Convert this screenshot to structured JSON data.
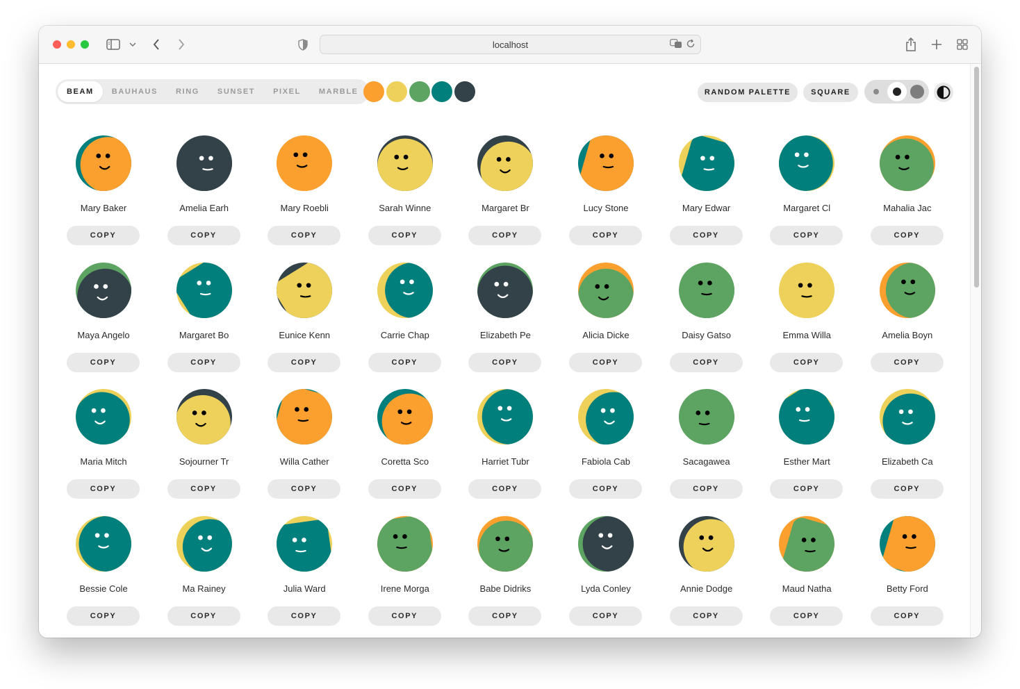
{
  "browser": {
    "url": "localhost",
    "traffic_lights": [
      "#ff5f57",
      "#febc2e",
      "#28c840"
    ]
  },
  "variants": {
    "tabs": [
      "BEAM",
      "BAUHAUS",
      "RING",
      "SUNSET",
      "PIXEL",
      "MARBLE"
    ],
    "active": "BEAM"
  },
  "palette": [
    "#fba02e",
    "#edd15b",
    "#5da361",
    "#007f7d",
    "#334149"
  ],
  "actions": {
    "random_palette": "RANDOM PALETTE",
    "square": "SQUARE"
  },
  "size_options": [
    "small",
    "medium",
    "large"
  ],
  "selected_size": "medium",
  "avatars": [
    {
      "name": "Mary Baker",
      "bg": "#007f7d",
      "face": "#fba02e",
      "features": "#000000"
    },
    {
      "name": "Amelia Earh",
      "bg": "#334149",
      "face": "#334149",
      "features": "#ffffff"
    },
    {
      "name": "Mary Roebli",
      "bg": "#fba02e",
      "face": "#fba02e",
      "features": "#000000"
    },
    {
      "name": "Sarah Winne",
      "bg": "#334149",
      "face": "#edd15b",
      "features": "#000000"
    },
    {
      "name": "Margaret Br",
      "bg": "#334149",
      "face": "#edd15b",
      "features": "#000000"
    },
    {
      "name": "Lucy Stone",
      "bg": "#007f7d",
      "face": "#fba02e",
      "features": "#000000"
    },
    {
      "name": "Mary Edwar",
      "bg": "#edd15b",
      "face": "#007f7d",
      "features": "#ffffff"
    },
    {
      "name": "Margaret Cl",
      "bg": "#edd15b",
      "face": "#007f7d",
      "features": "#ffffff"
    },
    {
      "name": "Mahalia Jac",
      "bg": "#fba02e",
      "face": "#5da361",
      "features": "#000000"
    },
    {
      "name": "Maya Angelo",
      "bg": "#5da361",
      "face": "#334149",
      "features": "#ffffff"
    },
    {
      "name": "Margaret Bo",
      "bg": "#edd15b",
      "face": "#007f7d",
      "features": "#ffffff"
    },
    {
      "name": "Eunice Kenn",
      "bg": "#334149",
      "face": "#edd15b",
      "features": "#000000"
    },
    {
      "name": "Carrie Chap",
      "bg": "#edd15b",
      "face": "#007f7d",
      "features": "#ffffff"
    },
    {
      "name": "Elizabeth Pe",
      "bg": "#5da361",
      "face": "#334149",
      "features": "#ffffff"
    },
    {
      "name": "Alicia Dicke",
      "bg": "#fba02e",
      "face": "#5da361",
      "features": "#000000"
    },
    {
      "name": "Daisy Gatso",
      "bg": "#5da361",
      "face": "#5da361",
      "features": "#000000"
    },
    {
      "name": "Emma Willa",
      "bg": "#edd15b",
      "face": "#edd15b",
      "features": "#000000"
    },
    {
      "name": "Amelia Boyn",
      "bg": "#fba02e",
      "face": "#5da361",
      "features": "#000000"
    },
    {
      "name": "Maria Mitch",
      "bg": "#edd15b",
      "face": "#007f7d",
      "features": "#ffffff"
    },
    {
      "name": "Sojourner Tr",
      "bg": "#334149",
      "face": "#edd15b",
      "features": "#000000"
    },
    {
      "name": "Willa Cather",
      "bg": "#007f7d",
      "face": "#fba02e",
      "features": "#000000"
    },
    {
      "name": "Coretta Sco",
      "bg": "#007f7d",
      "face": "#fba02e",
      "features": "#000000"
    },
    {
      "name": "Harriet Tubr",
      "bg": "#edd15b",
      "face": "#007f7d",
      "features": "#ffffff"
    },
    {
      "name": "Fabiola Cab",
      "bg": "#edd15b",
      "face": "#007f7d",
      "features": "#ffffff"
    },
    {
      "name": "Sacagawea",
      "bg": "#5da361",
      "face": "#5da361",
      "features": "#000000"
    },
    {
      "name": "Esther Mart",
      "bg": "#edd15b",
      "face": "#007f7d",
      "features": "#ffffff"
    },
    {
      "name": "Elizabeth Ca",
      "bg": "#edd15b",
      "face": "#007f7d",
      "features": "#ffffff"
    },
    {
      "name": "Bessie Cole",
      "bg": "#edd15b",
      "face": "#007f7d",
      "features": "#ffffff"
    },
    {
      "name": "Ma Rainey",
      "bg": "#edd15b",
      "face": "#007f7d",
      "features": "#ffffff"
    },
    {
      "name": "Julia Ward",
      "bg": "#edd15b",
      "face": "#007f7d",
      "features": "#ffffff"
    },
    {
      "name": "Irene Morga",
      "bg": "#fba02e",
      "face": "#5da361",
      "features": "#000000"
    },
    {
      "name": "Babe Didriks",
      "bg": "#fba02e",
      "face": "#5da361",
      "features": "#000000"
    },
    {
      "name": "Lyda Conley",
      "bg": "#5da361",
      "face": "#334149",
      "features": "#ffffff"
    },
    {
      "name": "Annie Dodge",
      "bg": "#334149",
      "face": "#edd15b",
      "features": "#000000"
    },
    {
      "name": "Maud Natha",
      "bg": "#fba02e",
      "face": "#5da361",
      "features": "#000000"
    },
    {
      "name": "Betty Ford",
      "bg": "#007f7d",
      "face": "#fba02e",
      "features": "#000000"
    }
  ],
  "copy_label": "COPY"
}
